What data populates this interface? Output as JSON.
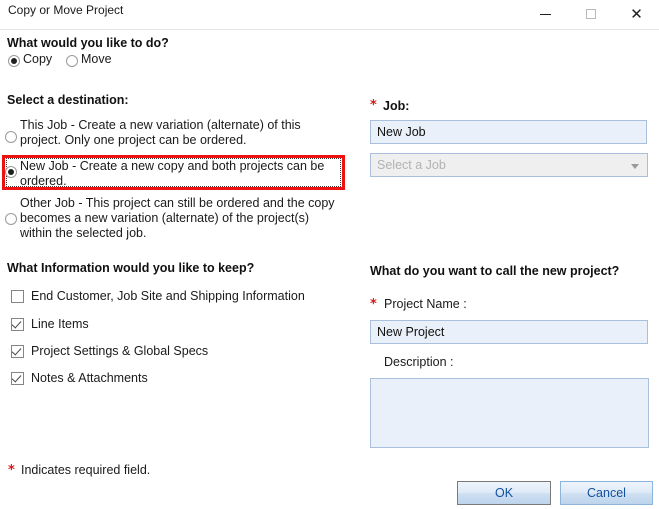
{
  "window": {
    "title": "Copy or Move Project",
    "controls": {
      "minimize": "minimize-icon",
      "maximize": "maximize-icon",
      "close": "close-icon"
    }
  },
  "action_section": {
    "heading": "What would you like to do?",
    "options": [
      {
        "label": "Copy",
        "selected": true
      },
      {
        "label": "Move",
        "selected": false
      }
    ]
  },
  "destination_section": {
    "heading": "Select a destination:",
    "options": [
      {
        "label": "This Job - Create a new variation (alternate) of this project.  Only one project can be ordered.",
        "selected": false,
        "highlighted": false
      },
      {
        "label": "New Job - Create a new copy and both projects can be ordered.",
        "selected": true,
        "highlighted": true
      },
      {
        "label": "Other Job - This project can still be ordered and the copy becomes a new variation (alternate) of the project(s) within the selected job.",
        "selected": false,
        "highlighted": false
      }
    ]
  },
  "keep_section": {
    "heading": "What Information would you like to keep?",
    "items": [
      {
        "label": "End Customer, Job Site and Shipping Information",
        "checked": false
      },
      {
        "label": "Line Items",
        "checked": true
      },
      {
        "label": "Project Settings & Global Specs",
        "checked": true
      },
      {
        "label": "Notes & Attachments",
        "checked": true
      }
    ]
  },
  "job_section": {
    "required_marker": "*",
    "label": "Job:",
    "job_name_value": "New Job",
    "job_select_placeholder": "Select a Job",
    "job_select_disabled": true
  },
  "project_section": {
    "heading": "What do you want to call the new project?",
    "required_marker": "*",
    "project_name_label": "Project Name :",
    "project_name_value": "New Project",
    "description_label": "Description :",
    "description_value": ""
  },
  "footer": {
    "required_marker": "*",
    "required_note": "Indicates required field.",
    "ok_label": "OK",
    "cancel_label": "Cancel"
  },
  "colors": {
    "required_red": "#d81818",
    "highlight_red": "#ee1111",
    "input_fill": "#e9f0fa",
    "input_border": "#a8c0dc",
    "button_text": "#14509e"
  }
}
